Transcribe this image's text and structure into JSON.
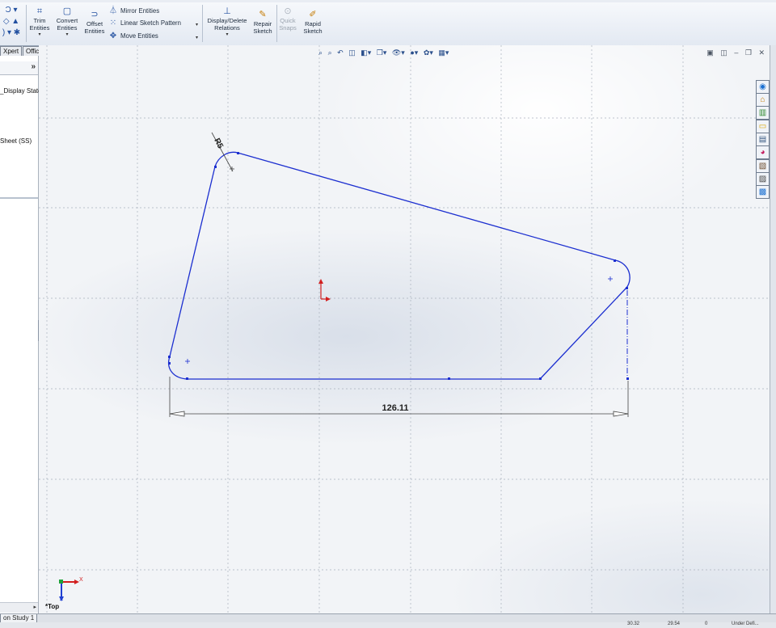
{
  "ribbon": {
    "trim": "Trim\nEntities",
    "convert": "Convert\nEntities",
    "offset": "Offset\nEntities",
    "mirror": "Mirror Entities",
    "linear_pattern": "Linear Sketch Pattern",
    "move": "Move Entities",
    "display_delete": "Display/Delete\nRelations",
    "repair": "Repair\nSketch",
    "quick_snaps": "Quick\nSnaps",
    "rapid": "Rapid\nSketch"
  },
  "tabs": [
    "Xpert",
    "Office Products"
  ],
  "left_panel": {
    "chevron": "»",
    "item1": "_Display State",
    "item2": "Sheet (SS)"
  },
  "sketch": {
    "radius_label": "R5",
    "dimension_label": "126.11",
    "view_name": "*Top",
    "axis_x": "X",
    "axis_z": "Z",
    "line_color": "#1c2fd0"
  },
  "bottom": {
    "tab_label": "on Study 1"
  },
  "status": {
    "values": [
      "30.32",
      "29.54",
      "0",
      "Under Defi..."
    ]
  },
  "icons": {
    "headsup": [
      "zoom-fit-icon",
      "zoom-area-icon",
      "previous-view-icon",
      "section-view-icon",
      "view-orientation-icon",
      "display-style-icon",
      "hide-show-icon",
      "edit-appearance-icon",
      "apply-scene-icon",
      "view-settings-icon"
    ],
    "taskpane": [
      "solidworks-resources-icon",
      "design-library-icon",
      "file-explorer-icon",
      "folder-icon",
      "view-palette-icon",
      "appearances-icon",
      "custom-properties-icon",
      "toolbox-icon",
      "forum-icon"
    ]
  }
}
